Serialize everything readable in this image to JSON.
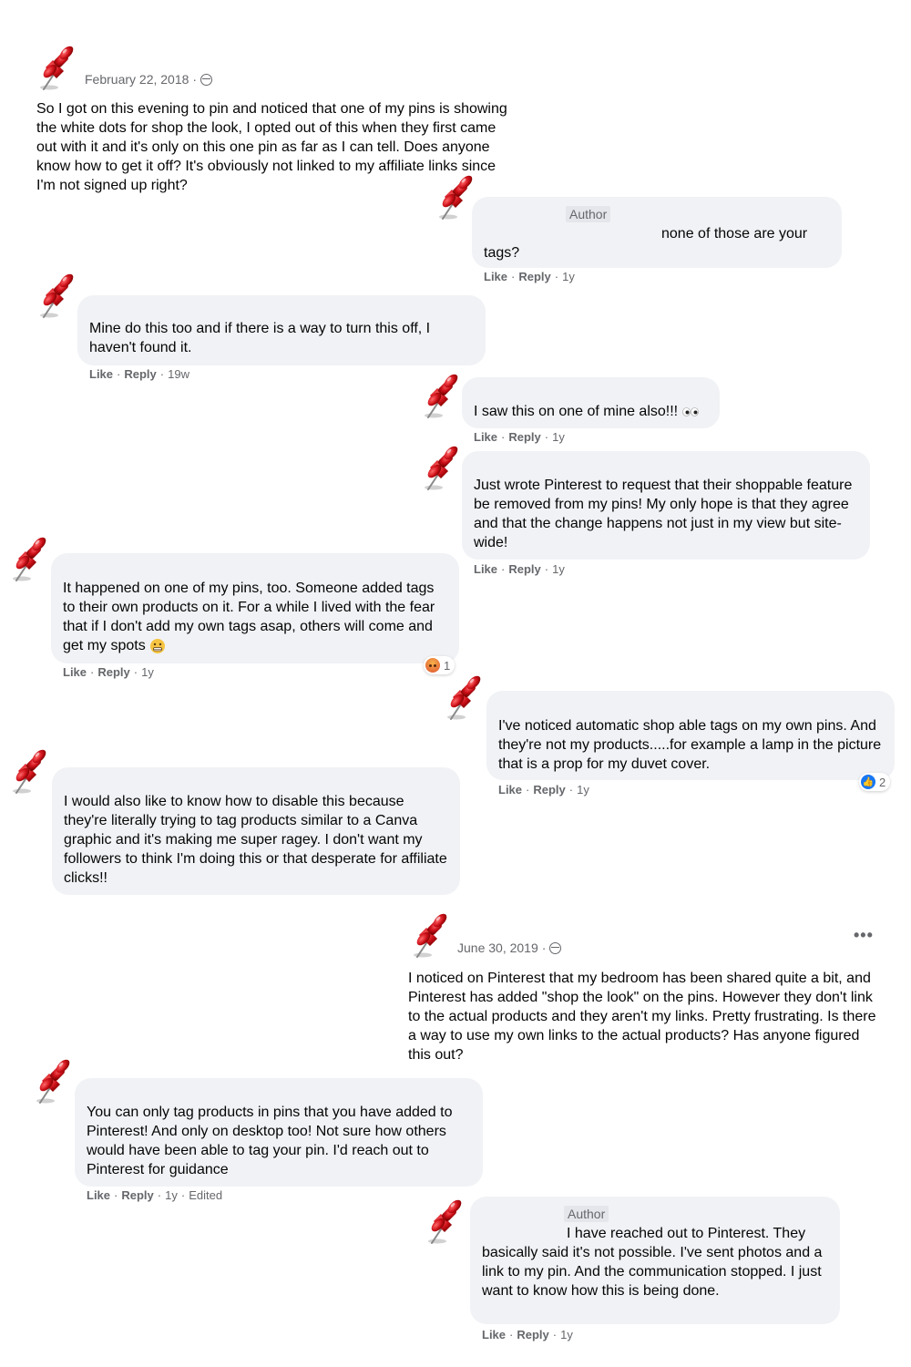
{
  "post1": {
    "date": "February 22, 2018",
    "dot": "·",
    "text": "So I got on this evening to pin and noticed that one of my pins is showing the white dots for shop the look, I opted out of this when they first came out with it and it's only on this one pin as far as I can tell. Does anyone know how to get it off? It's obviously not linked to my affiliate links since I'm not signed up right?"
  },
  "comments": [
    {
      "author_badge": "Author",
      "text": "none of those are your tags?",
      "like": "Like",
      "reply": "Reply",
      "time": "1y"
    },
    {
      "text": "Mine do this too and if there is a way to turn this off, I haven't found it.",
      "like": "Like",
      "reply": "Reply",
      "time": "19w"
    },
    {
      "text": "I saw this on one of mine also!!!",
      "like": "Like",
      "reply": "Reply",
      "time": "1y"
    },
    {
      "text": "Just wrote Pinterest to request that their shoppable feature be removed from my pins! My only hope is that they agree and that the change happens not just in my view but site-wide!",
      "like": "Like",
      "reply": "Reply",
      "time": "1y"
    },
    {
      "text": "It happened on one of my pins, too. Someone added tags to their own products on it. For a while I lived with the fear that if I don't add my own tags asap, others will come and get my spots",
      "like": "Like",
      "reply": "Reply",
      "time": "1y",
      "reaction_count": "1"
    },
    {
      "text": "I've noticed automatic shop able tags on my own pins. And they're not my products.....for example a lamp in the picture that is a prop for my duvet cover.",
      "like": "Like",
      "reply": "Reply",
      "time": "1y",
      "reaction_count": "2"
    },
    {
      "text": "I would also like to know how to disable this because they're literally trying to tag products similar to a Canva graphic and it's making me super ragey. I don't want my followers to think I'm doing this or that desperate for affiliate clicks!!"
    }
  ],
  "post2": {
    "date": "June 30, 2019",
    "dot": "·",
    "more": "•••",
    "text": "I noticed on Pinterest that my bedroom has been shared quite a bit, and Pinterest has added \"shop the look\" on the pins. However they don't link to the actual products and they aren't my links. Pretty frustrating.  Is there a way to use my own links to the actual products? Has anyone figured this out?"
  },
  "comments2": [
    {
      "text": "You can only tag products in pins that you have added to Pinterest! And only on desktop too! Not sure how others would have been able to tag your pin. I'd reach out to Pinterest for guidance",
      "like": "Like",
      "reply": "Reply",
      "time": "1y",
      "edited": "Edited"
    },
    {
      "author_badge": "Author",
      "text": "I have reached out to Pinterest. They basically said it's not possible. I've sent photos and a link to my pin. And the communication stopped. I just want to know how this is being done.",
      "like": "Like",
      "reply": "Reply",
      "time": "1y"
    }
  ],
  "sep": "·",
  "icons": {
    "pin": "pushpin-icon",
    "globe": "globe-icon",
    "angry": "angry-reaction-icon",
    "like": "like-reaction-icon"
  },
  "colors": {
    "bubble": "#f0f2f5",
    "meta": "#65676b",
    "pin_red": "#d0121b",
    "like_blue": "#1877f2"
  }
}
